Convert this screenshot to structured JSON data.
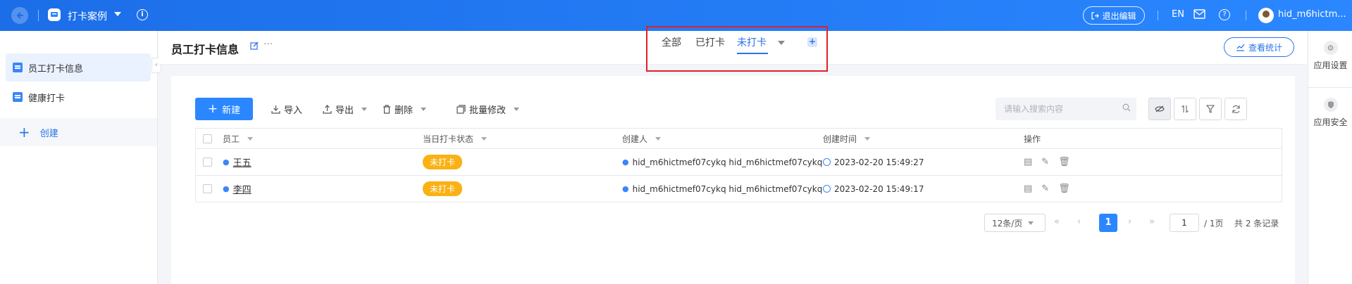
{
  "topbar": {
    "app_name": "打卡案例",
    "exit_edit": "退出编辑",
    "lang": "EN",
    "user": "hid_m6hictm..."
  },
  "sidebar": {
    "items": [
      {
        "label": "员工打卡信息",
        "icon": "doc-icon",
        "active": true
      },
      {
        "label": "健康打卡",
        "icon": "doc-icon",
        "active": false
      }
    ],
    "create": "创建"
  },
  "header": {
    "title": "员工打卡信息",
    "tabs": [
      {
        "label": "全部",
        "active": false
      },
      {
        "label": "已打卡",
        "active": false
      },
      {
        "label": "未打卡",
        "active": true
      }
    ],
    "stats_button": "查看统计"
  },
  "rightbar": {
    "items": [
      {
        "label": "应用设置",
        "icon": "gear-icon"
      },
      {
        "label": "应用安全",
        "icon": "shield-icon"
      }
    ]
  },
  "toolbar": {
    "new": "新建",
    "import": "导入",
    "export": "导出",
    "delete": "删除",
    "batch_edit": "批量修改",
    "search_placeholder": "请输入搜索内容"
  },
  "table": {
    "columns": [
      "员工",
      "当日打卡状态",
      "创建人",
      "创建时间",
      "操作"
    ],
    "rows": [
      {
        "employee": "王五",
        "status": "未打卡",
        "creator": "hid_m6hictmef07cykq hid_m6hictmef07cykq",
        "created": "2023-02-20 15:49:27"
      },
      {
        "employee": "李四",
        "status": "未打卡",
        "creator": "hid_m6hictmef07cykq hid_m6hictmef07cykq",
        "created": "2023-02-20 15:49:17"
      }
    ]
  },
  "pager": {
    "page_size": "12条/页",
    "current": "1",
    "jump_value": "1",
    "total_pages": "/ 1页",
    "record_count": "共 2 条记录"
  },
  "colors": {
    "primary": "#2a87ff",
    "badge": "#f9b114",
    "highlight": "#e0202a"
  }
}
